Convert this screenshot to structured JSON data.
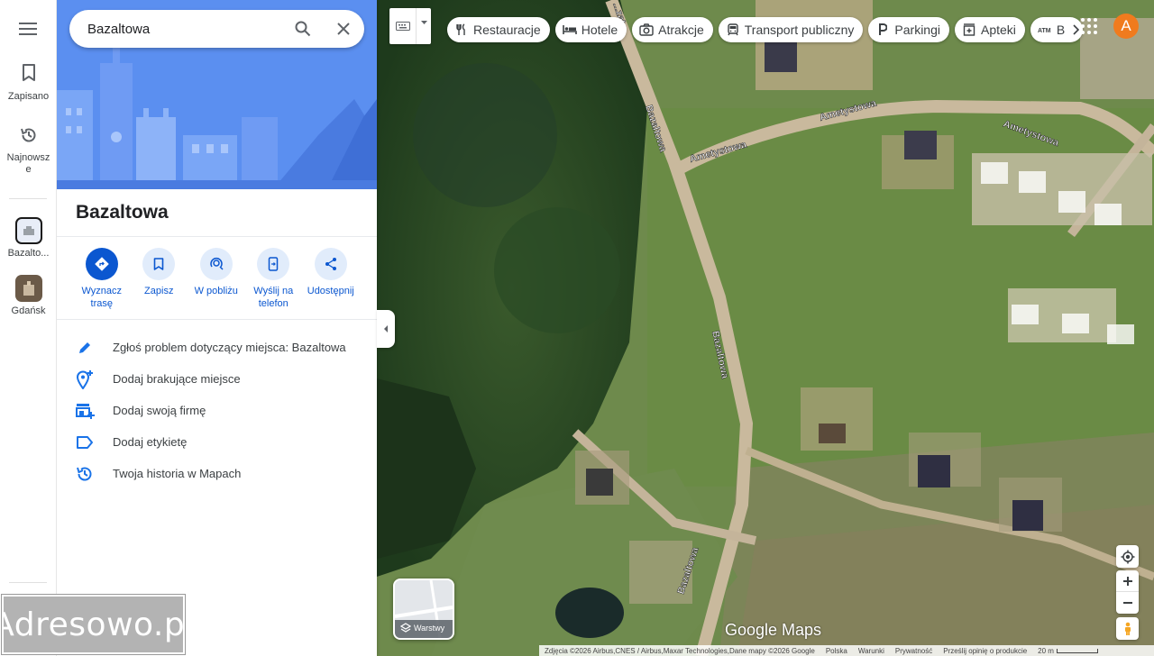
{
  "search": {
    "value": "Bazaltowa"
  },
  "rail": {
    "saved_label": "Zapisano",
    "recent_label_line1": "Najnowsz",
    "recent_label_line2": "e",
    "recent_items": [
      {
        "label": "Bazalto..."
      },
      {
        "label": "Gdańsk"
      }
    ]
  },
  "place": {
    "title": "Bazaltowa",
    "actions": [
      {
        "label_line1": "Wyznacz",
        "label_line2": "trasę",
        "icon": "directions-icon"
      },
      {
        "label_line1": "Zapisz",
        "label_line2": "",
        "icon": "bookmark-icon"
      },
      {
        "label_line1": "W pobliżu",
        "label_line2": "",
        "icon": "nearby-icon"
      },
      {
        "label_line1": "Wyślij na",
        "label_line2": "telefon",
        "icon": "send-to-phone-icon"
      },
      {
        "label_line1": "Udostępnij",
        "label_line2": "",
        "icon": "share-icon"
      }
    ],
    "list": [
      {
        "text": "Zgłoś problem dotyczący miejsca: Bazaltowa",
        "icon": "pencil-icon"
      },
      {
        "text": "Dodaj brakujące miejsce",
        "icon": "add-location-icon"
      },
      {
        "text": "Dodaj swoją firmę",
        "icon": "add-business-icon"
      },
      {
        "text": "Dodaj etykietę",
        "icon": "label-icon"
      },
      {
        "text": "Twoja historia w Mapach",
        "icon": "history-icon"
      }
    ]
  },
  "watermark": "Adresowo.pl",
  "chips": [
    {
      "label": "Restauracje",
      "icon": "restaurant-icon"
    },
    {
      "label": "Hotele",
      "icon": "hotel-icon"
    },
    {
      "label": "Atrakcje",
      "icon": "camera-icon"
    },
    {
      "label": "Transport publiczny",
      "icon": "transit-icon"
    },
    {
      "label": "Parkingi",
      "icon": "parking-icon"
    },
    {
      "label": "Apteki",
      "icon": "pharmacy-icon"
    },
    {
      "label": "B",
      "icon": "atm-icon"
    }
  ],
  "avatar_letter": "A",
  "layers_label": "Warstwy",
  "map_labels": {
    "road1": "Bazaltowa",
    "road2": "Bazaltowa",
    "road3": "Bazaltowa",
    "road4": "Ametystowa",
    "road5": "Ametystowa",
    "road6": "Ametystowa",
    "top_cut": "...zat"
  },
  "logo": "Google Maps",
  "footer": {
    "credits": "Zdjęcia ©2026 Airbus,CNES / Airbus,Maxar Technologies,Dane mapy ©2026 Google",
    "country": "Polska",
    "terms": "Warunki",
    "privacy": "Prywatność",
    "feedback": "Prześlij opinię o produkcie",
    "scale": "20 m"
  },
  "colors": {
    "accent": "#0b57d0",
    "hero_blue": "#5b8ff0",
    "avatar_orange": "#f07b1e"
  }
}
